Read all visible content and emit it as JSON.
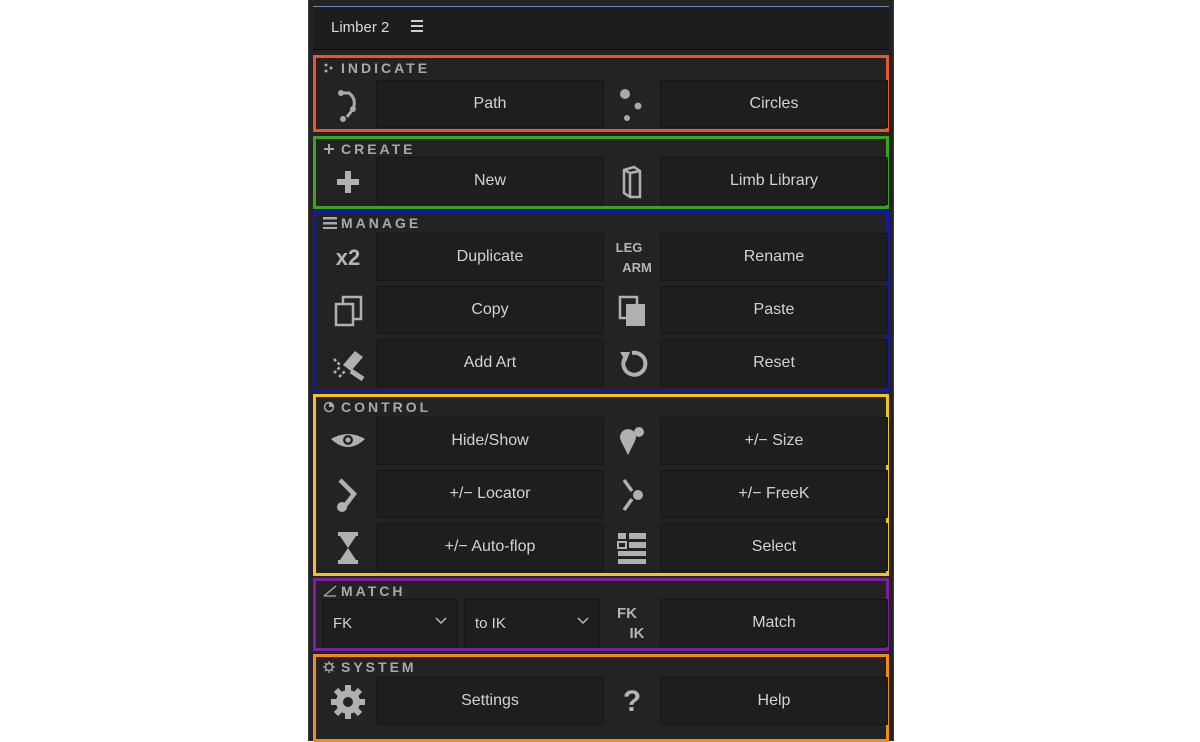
{
  "window": {
    "title": "Limber 2"
  },
  "colors": {
    "indicate_border": "#e8572a",
    "create_border": "#3aa41f",
    "manage_border": "#1616a8",
    "control_border": "#f0c321",
    "match_border": "#7c1fa0",
    "system_border": "#ef8c1a"
  },
  "sections": {
    "indicate": {
      "title": "INDICATE",
      "buttons": [
        "Path",
        "Circles"
      ]
    },
    "create": {
      "title": "CREATE",
      "buttons": [
        "New",
        "Limb Library"
      ]
    },
    "manage": {
      "title": "MANAGE",
      "buttons": [
        "Duplicate",
        "Rename",
        "Copy",
        "Paste",
        "Add Art",
        "Reset"
      ],
      "icon_labels": {
        "duplicate": "x2",
        "rename_top": "LEG",
        "rename_bottom": "ARM"
      }
    },
    "control": {
      "title": "CONTROL",
      "buttons": [
        "Hide/Show",
        "+/− Size",
        "+/− Locator",
        "+/− FreeK",
        "+/− Auto-flop",
        "Select"
      ]
    },
    "match": {
      "title": "MATCH",
      "from_select": "FK",
      "to_select": "to IK",
      "button": "Match",
      "icon_labels": {
        "top": "FK",
        "bottom": "IK"
      }
    },
    "system": {
      "title": "SYSTEM",
      "buttons": [
        "Settings",
        "Help"
      ],
      "help_icon": "?"
    }
  }
}
